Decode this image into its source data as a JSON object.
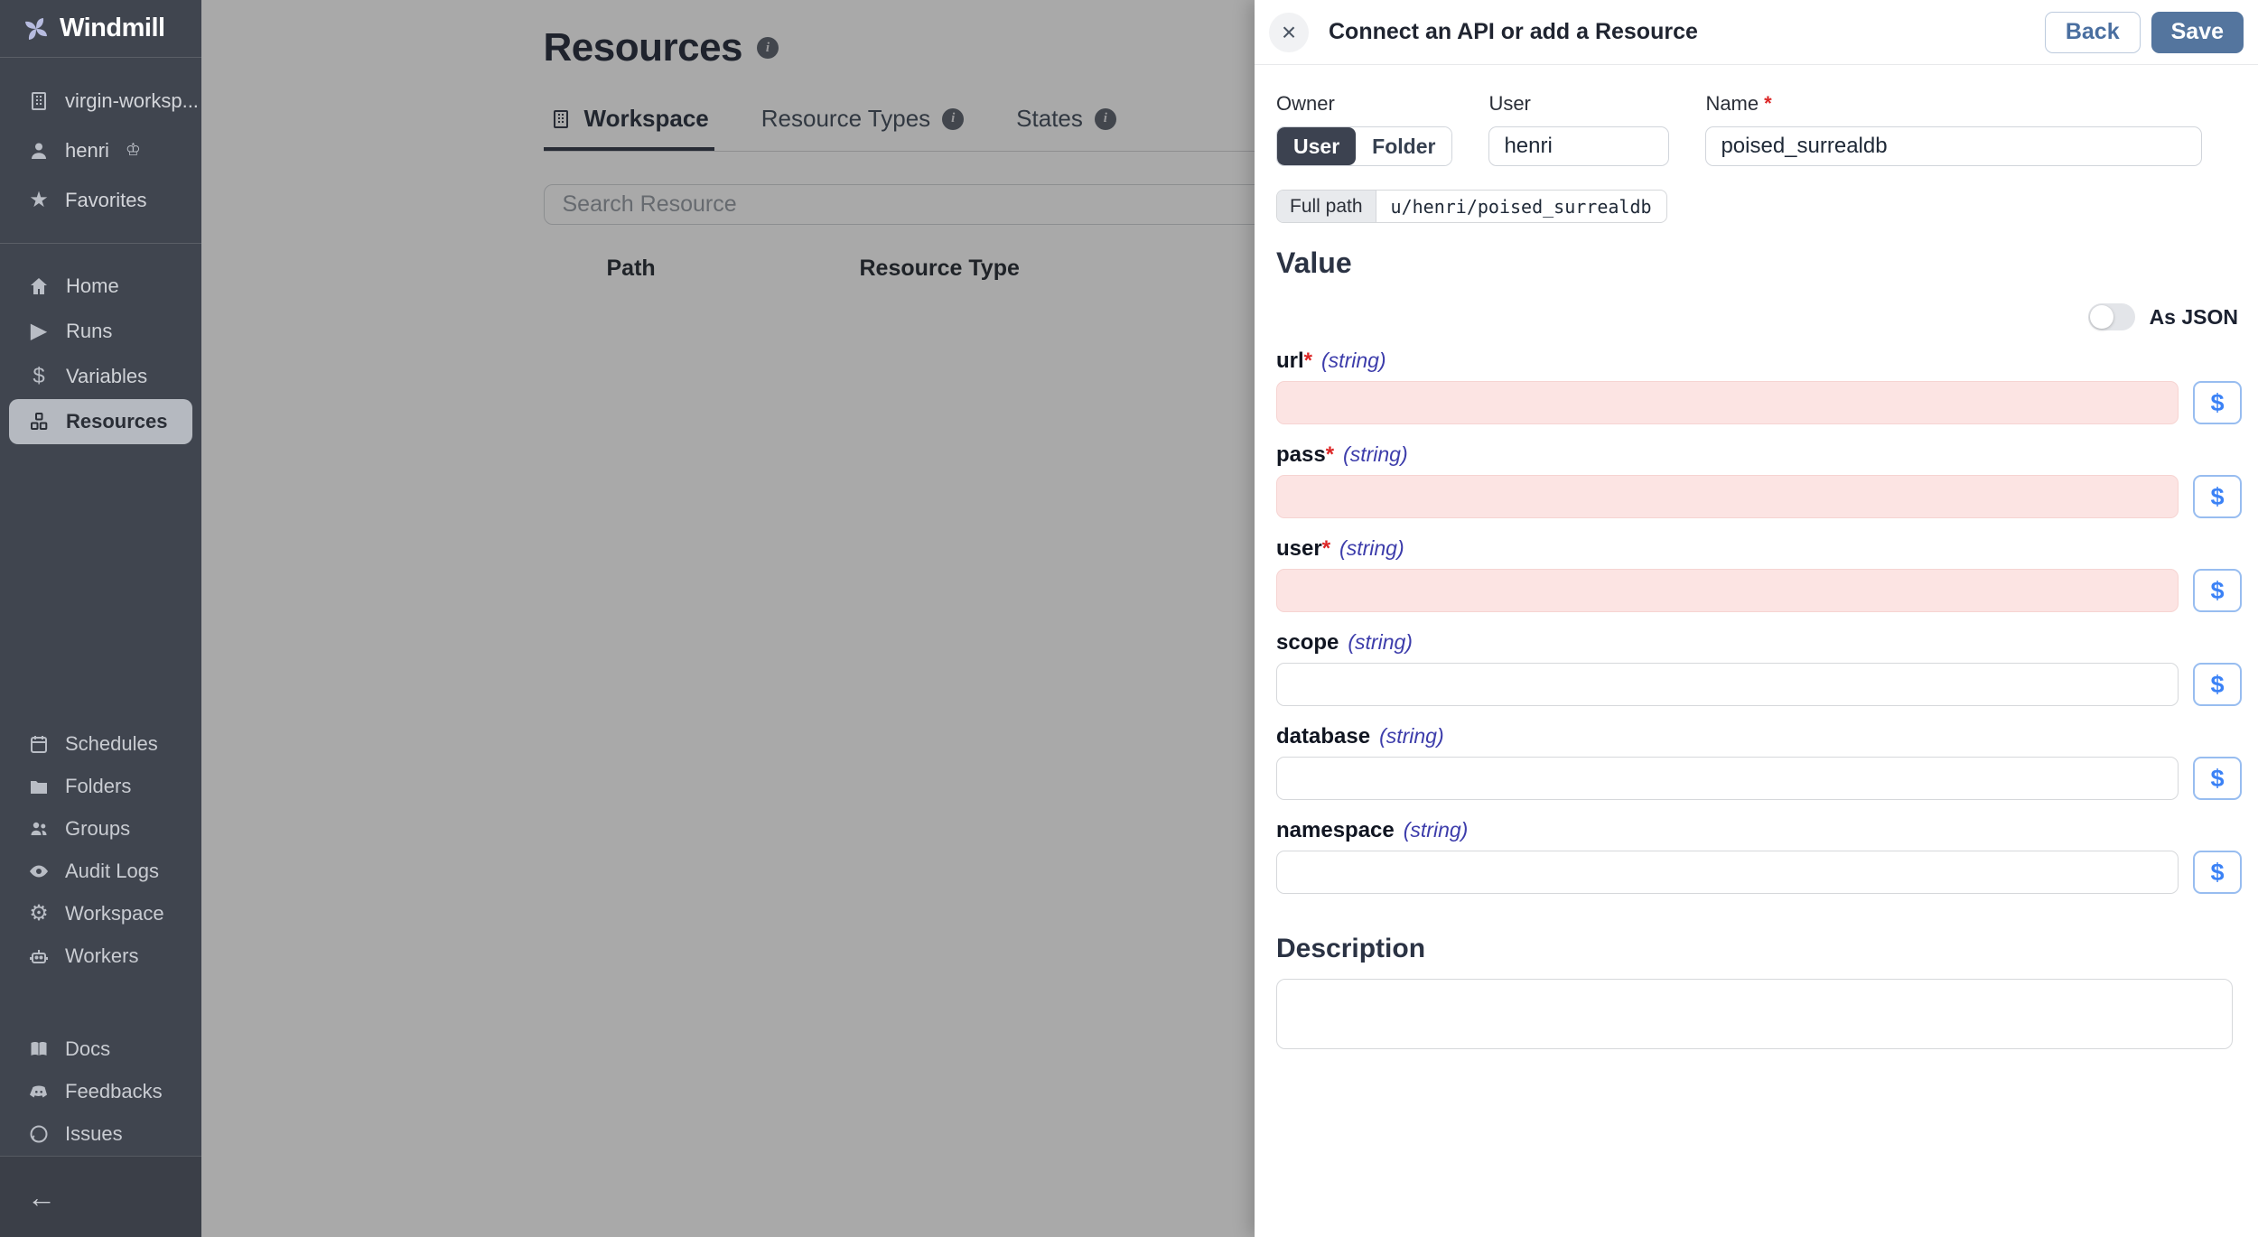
{
  "app": {
    "name": "Windmill"
  },
  "icons": {
    "star": "★",
    "play": "▶",
    "dollar": "$",
    "gear": "⚙",
    "crown": "♔",
    "back_arrow": "←",
    "close": "×",
    "info": "i"
  },
  "colors": {
    "sidebar_bg": "#40454f",
    "active_pill": "#b5b9c0",
    "save_blue": "#54759e",
    "link_blue": "#3b82f6",
    "required_pink": "#fce4e3",
    "red": "#dc2626",
    "type_indigo": "#3d3dab"
  },
  "sidebar": {
    "workspace_items": [
      {
        "label": "virgin-worksp...",
        "icon": "building-icon"
      },
      {
        "label": "henri",
        "icon": "user-icon"
      },
      {
        "label": "Favorites",
        "icon": "star-icon"
      }
    ],
    "nav_items": [
      {
        "label": "Home",
        "icon": "home-icon"
      },
      {
        "label": "Runs",
        "icon": "play-icon"
      },
      {
        "label": "Variables",
        "icon": "dollar-icon"
      },
      {
        "label": "Resources",
        "icon": "boxes-icon"
      }
    ],
    "admin_items": [
      {
        "label": "Schedules",
        "icon": "calendar-icon"
      },
      {
        "label": "Folders",
        "icon": "folder-icon"
      },
      {
        "label": "Groups",
        "icon": "users-icon"
      },
      {
        "label": "Audit Logs",
        "icon": "eye-icon"
      },
      {
        "label": "Workspace",
        "icon": "gear-icon"
      },
      {
        "label": "Workers",
        "icon": "robot-icon"
      }
    ],
    "footer_items": [
      {
        "label": "Docs",
        "icon": "book-icon"
      },
      {
        "label": "Feedbacks",
        "icon": "discord-icon"
      },
      {
        "label": "Issues",
        "icon": "github-icon"
      }
    ]
  },
  "main": {
    "title": "Resources",
    "tabs": [
      {
        "label": "Workspace"
      },
      {
        "label": "Resource Types"
      },
      {
        "label": "States"
      }
    ],
    "search_placeholder": "Search Resource",
    "table_headers": {
      "path": "Path",
      "type": "Resource Type"
    }
  },
  "drawer": {
    "title": "Connect an API or add a Resource",
    "back_label": "Back",
    "save_label": "Save",
    "required_marker": "*",
    "dollar_label": "$",
    "owner": {
      "label": "Owner",
      "option_user": "User",
      "option_folder": "Folder",
      "selected": "User"
    },
    "user_field": {
      "label": "User",
      "value": "henri"
    },
    "name_field": {
      "label": "Name",
      "value": "poised_surrealdb"
    },
    "full_path": {
      "label": "Full path",
      "value": "u/henri/poised_surrealdb"
    },
    "value_section": {
      "heading": "Value",
      "as_json_label": "As JSON",
      "as_json_enabled": false
    },
    "fields": [
      {
        "name": "url",
        "type": "(string)",
        "required": true,
        "value": ""
      },
      {
        "name": "pass",
        "type": "(string)",
        "required": true,
        "value": ""
      },
      {
        "name": "user",
        "type": "(string)",
        "required": true,
        "value": ""
      },
      {
        "name": "scope",
        "type": "(string)",
        "required": false,
        "value": ""
      },
      {
        "name": "database",
        "type": "(string)",
        "required": false,
        "value": ""
      },
      {
        "name": "namespace",
        "type": "(string)",
        "required": false,
        "value": ""
      }
    ],
    "description_section": {
      "heading": "Description",
      "value": ""
    }
  }
}
